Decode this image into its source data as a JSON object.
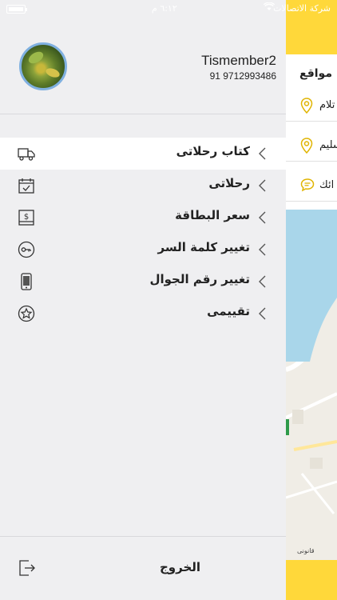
{
  "status_bar": {
    "carrier": "شركة الاتصالات",
    "time": "٦:١٢ م"
  },
  "profile": {
    "name": "Tismember2",
    "phone": "91 9712993486"
  },
  "menu": {
    "items": [
      {
        "label": "كتاب رحلاتى",
        "icon": "truck-icon",
        "active": true
      },
      {
        "label": "رحلاتى",
        "icon": "calendar-icon",
        "active": false
      },
      {
        "label": "سعر البطاقة",
        "icon": "price-card-icon",
        "active": false
      },
      {
        "label": "تغيير كلمة السر",
        "icon": "key-icon",
        "active": false
      },
      {
        "label": "تغيير رقم الجوال",
        "icon": "mobile-phone-icon",
        "active": false
      },
      {
        "label": "تقييمى",
        "icon": "star-icon",
        "active": false
      }
    ]
  },
  "logout": {
    "label": "الخروج",
    "icon": "logout-icon"
  },
  "main_panel": {
    "section_title": "مواقع",
    "rows": [
      {
        "text": "تلام",
        "icon": "location-pin-icon"
      },
      {
        "text": "سليم",
        "icon": "location-pin-icon"
      },
      {
        "text": "ائك",
        "icon": "chat-bubble-icon"
      }
    ],
    "map_credit": "قانونى"
  },
  "colors": {
    "accent_yellow": "#ffd83a",
    "drawer_bg": "#efeff1",
    "active_row_bg": "#ffffff",
    "text": "#222222"
  }
}
